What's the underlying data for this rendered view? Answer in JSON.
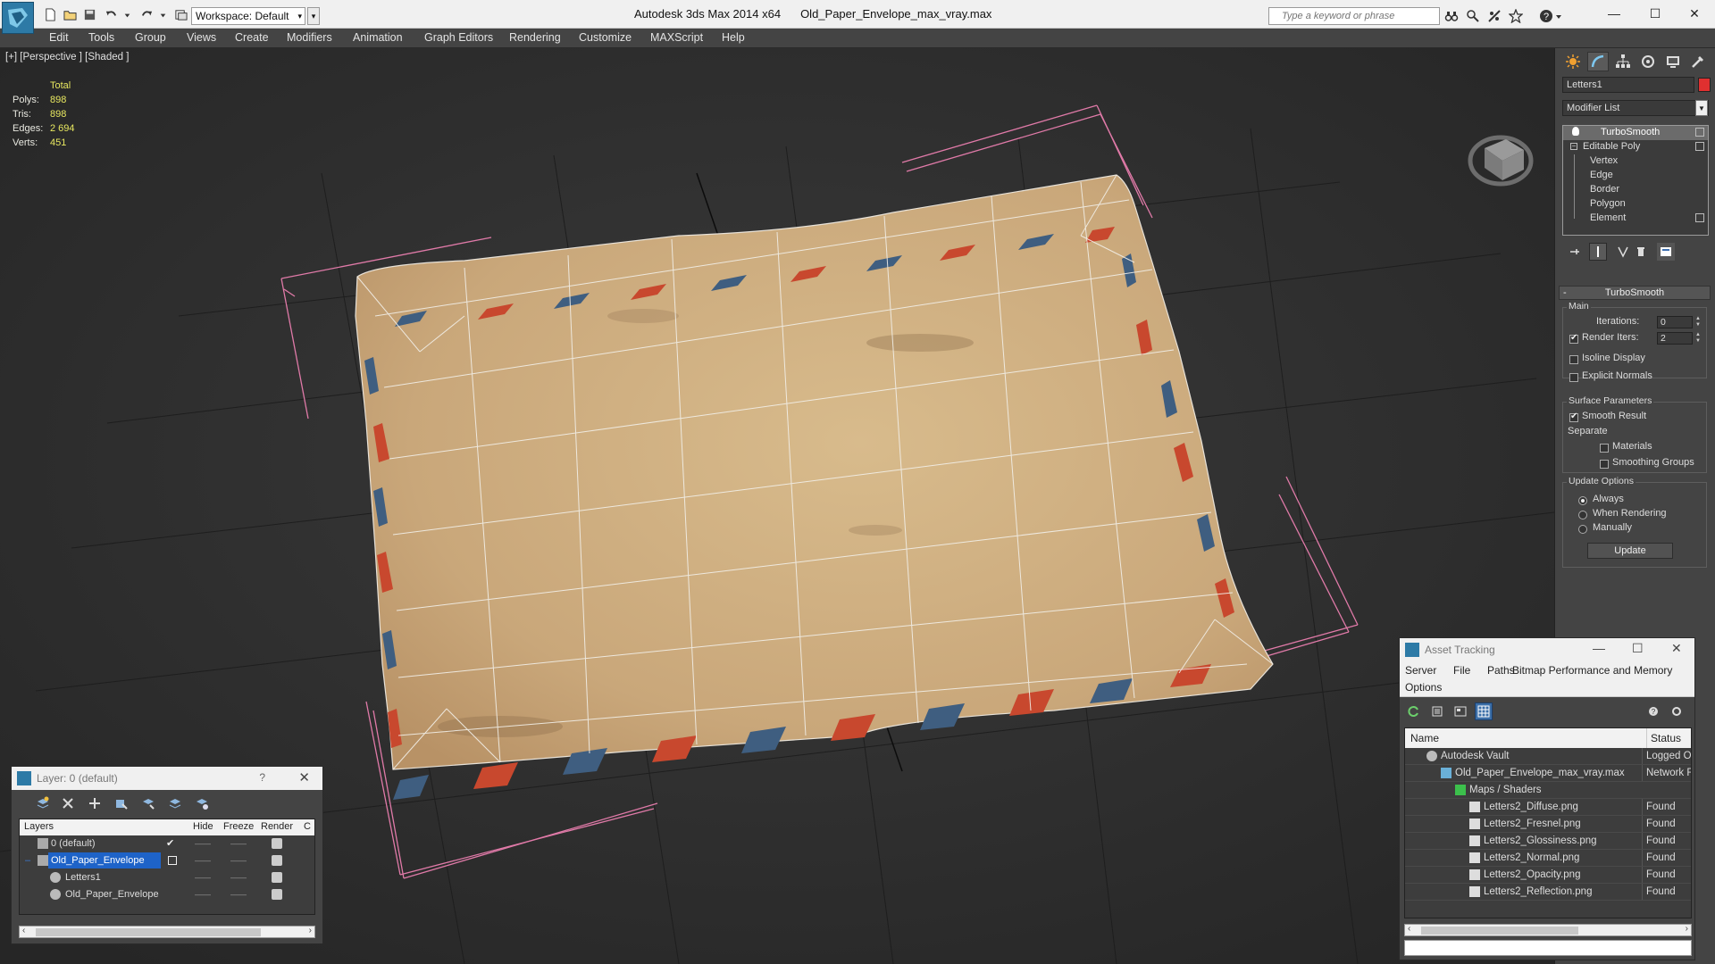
{
  "titlebar": {
    "workspace": "Workspace: Default",
    "app_name": "Autodesk 3ds Max  2014 x64",
    "file_name": "Old_Paper_Envelope_max_vray.max",
    "search_placeholder": "Type a keyword or phrase",
    "minimize": "—",
    "maximize": "☐",
    "close": "✕"
  },
  "menu": [
    "Edit",
    "Tools",
    "Group",
    "Views",
    "Create",
    "Modifiers",
    "Animation",
    "Graph Editors",
    "Rendering",
    "Customize",
    "MAXScript",
    "Help"
  ],
  "viewport": {
    "label": "[+] [Perspective ] [Shaded ]",
    "stats": {
      "header": "Total",
      "rows": [
        {
          "label": "Polys:",
          "value": "898"
        },
        {
          "label": "Tris:",
          "value": "898"
        },
        {
          "label": "Edges:",
          "value": "2 694"
        },
        {
          "label": "Verts:",
          "value": "451"
        }
      ]
    }
  },
  "command_panel": {
    "object_name": "Letters1",
    "modifier_list": "Modifier List",
    "stack": [
      {
        "label": "TurboSmooth",
        "level": 0
      },
      {
        "label": "Editable Poly",
        "level": 0
      },
      {
        "label": "Vertex",
        "level": 1
      },
      {
        "label": "Edge",
        "level": 1
      },
      {
        "label": "Border",
        "level": 1
      },
      {
        "label": "Polygon",
        "level": 1
      },
      {
        "label": "Element",
        "level": 1
      }
    ],
    "rollout_title": "TurboSmooth",
    "main": {
      "title": "Main",
      "iterations_label": "Iterations:",
      "iterations_value": "0",
      "render_iters_label": "Render Iters:",
      "render_iters_value": "2",
      "isoline_label": "Isoline Display",
      "explicit_label": "Explicit Normals"
    },
    "surface": {
      "title": "Surface Parameters",
      "smooth_result": "Smooth Result",
      "separate": "Separate",
      "materials": "Materials",
      "smoothing_groups": "Smoothing Groups"
    },
    "update": {
      "title": "Update Options",
      "always": "Always",
      "when_rendering": "When Rendering",
      "manually": "Manually",
      "button": "Update"
    }
  },
  "layer_dialog": {
    "title": "Layer: 0 (default)",
    "help": "?",
    "close": "✕",
    "columns": [
      "Layers",
      "Hide",
      "Freeze",
      "Render",
      "C"
    ],
    "rows": [
      {
        "name": "0 (default)"
      },
      {
        "name": "Old_Paper_Envelope"
      },
      {
        "name": "Letters1"
      },
      {
        "name": "Old_Paper_Envelope"
      }
    ]
  },
  "asset_tracking": {
    "title": "Asset Tracking",
    "menu": [
      "Server",
      "File",
      "Paths",
      "Bitmap Performance and Memory",
      "Options"
    ],
    "columns": [
      "Name",
      "Status"
    ],
    "rows": [
      {
        "name": "Autodesk Vault",
        "status": "Logged O"
      },
      {
        "name": "Old_Paper_Envelope_max_vray.max",
        "status": "Network F"
      },
      {
        "name": "Maps / Shaders",
        "status": ""
      },
      {
        "name": "Letters2_Diffuse.png",
        "status": "Found"
      },
      {
        "name": "Letters2_Fresnel.png",
        "status": "Found"
      },
      {
        "name": "Letters2_Glossiness.png",
        "status": "Found"
      },
      {
        "name": "Letters2_Normal.png",
        "status": "Found"
      },
      {
        "name": "Letters2_Opacity.png",
        "status": "Found"
      },
      {
        "name": "Letters2_Reflection.png",
        "status": "Found"
      }
    ]
  },
  "colors": {
    "accent": "#1e63c8",
    "envelope": "#c9a77a",
    "stripe_red": "#c8482e",
    "stripe_blue": "#3f5e80",
    "bbox": "#e07aa8",
    "object_color": "#e03030"
  }
}
